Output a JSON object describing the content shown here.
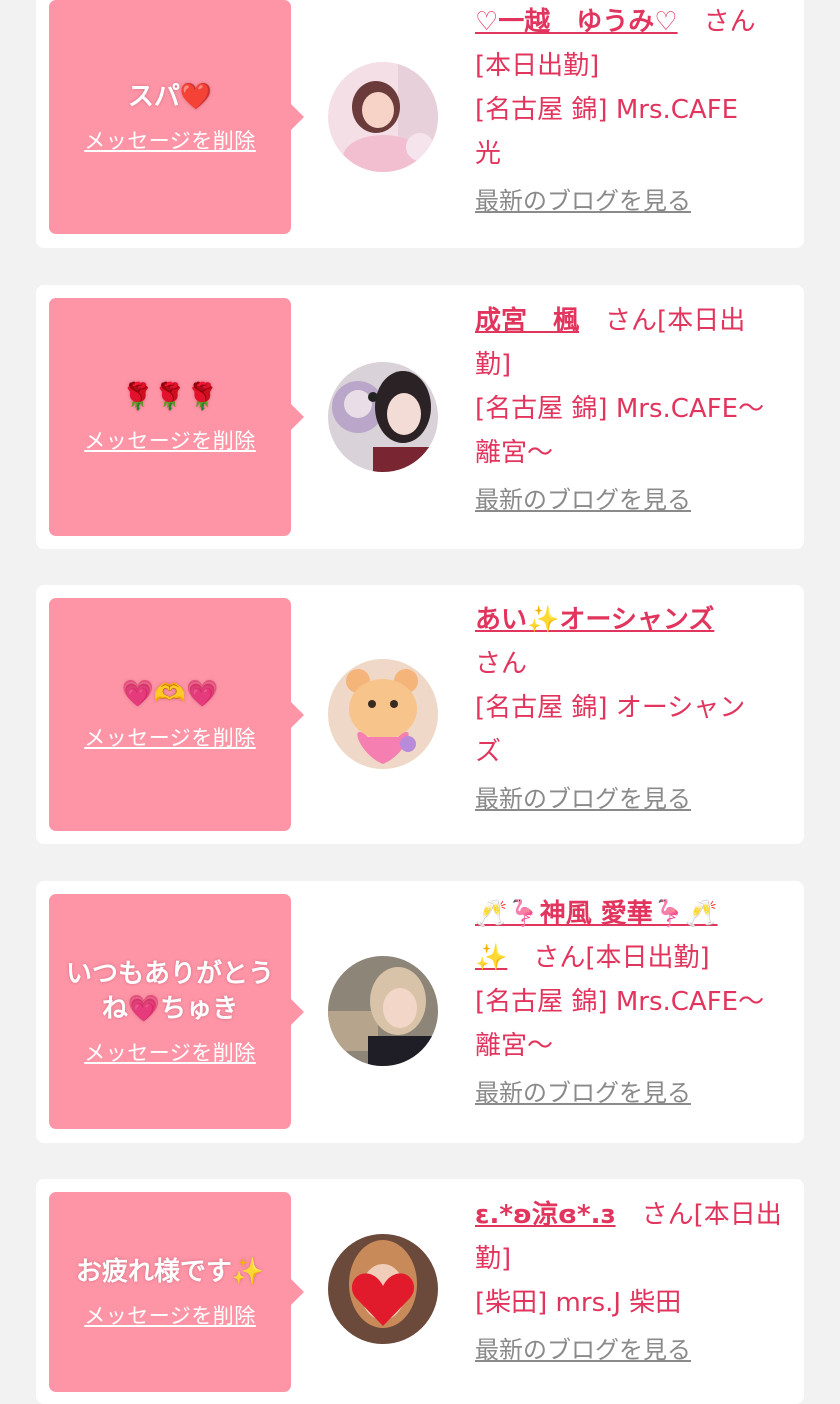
{
  "delete_label": "メッセージを削除",
  "blog_label": "最新のブログを見る",
  "san_label": "さん",
  "colors": {
    "accent": "#e2355e",
    "bubble": "#fe95a7",
    "background": "#f2f2f2"
  },
  "messages": [
    {
      "message": "スパ❤️",
      "name": "♡一越　ゆうみ♡",
      "line1": "[本日出勤]",
      "line2": "[名古屋 錦] Mrs.CAFE",
      "line3": "光"
    },
    {
      "message": "🌹🌹🌹",
      "name": "成宮　楓",
      "suffix": "[本日出",
      "line1": "勤]",
      "line2": "[名古屋 錦] Mrs.CAFE〜",
      "line3": "離宮〜"
    },
    {
      "message": "💗🫶💗",
      "name": "あい✨オーシャンズ",
      "line1": "",
      "line2": "[名古屋 錦] オーシャン",
      "line3": "ズ"
    },
    {
      "message": "いつもありがとうね💗ちゅき",
      "name": "🥂🦩神風 愛華🦩🥂",
      "name2": "✨",
      "suffix": "[本日出勤]",
      "line2": "[名古屋 錦] Mrs.CAFE〜",
      "line3": "離宮〜"
    },
    {
      "message": "お疲れ様です✨",
      "name": "ε.*ʚ涼ɞ*.з",
      "suffix": "[本日出",
      "line1": "勤]",
      "line2": "[柴田] mrs.J 柴田"
    }
  ]
}
